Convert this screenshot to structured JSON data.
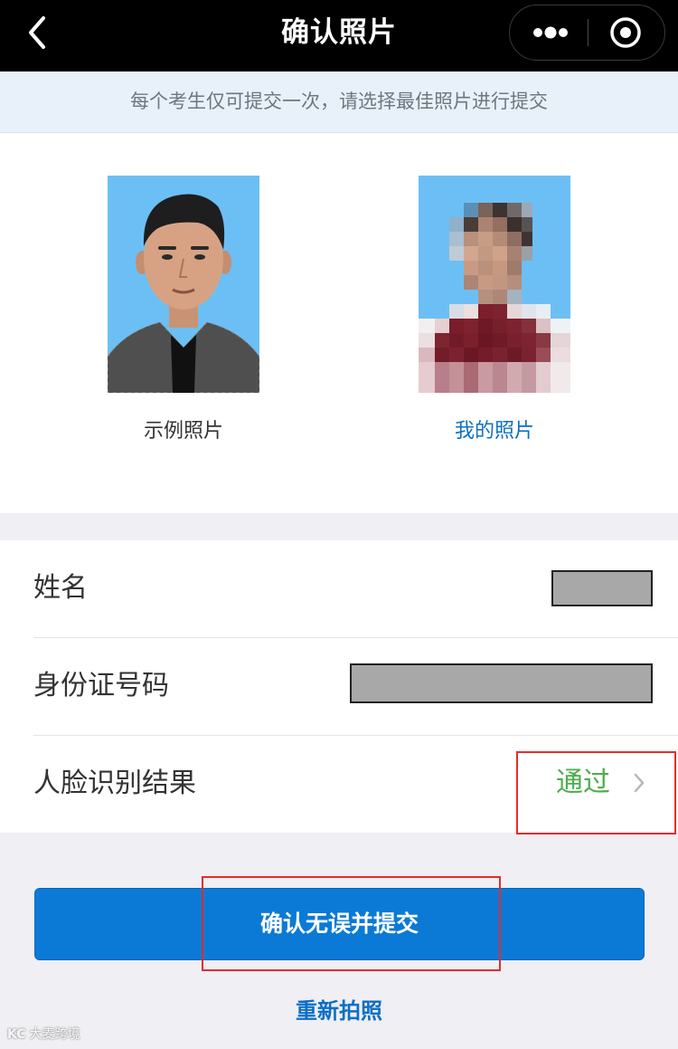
{
  "navbar": {
    "title": "确认照片",
    "back_icon": "chevron-left-icon",
    "more_icon": "more-dots-icon",
    "close_icon": "target-close-icon"
  },
  "notice": {
    "text": "每个考生仅可提交一次，请选择最佳照片进行提交"
  },
  "photos": {
    "sample_caption": "示例照片",
    "mine_caption": "我的照片"
  },
  "info": {
    "name_label": "姓名",
    "id_label": "身份证号码",
    "face_label": "人脸识别结果",
    "face_result": "通过"
  },
  "actions": {
    "submit_label": "确认无误并提交",
    "retake_label": "重新拍照"
  },
  "watermark": {
    "logo": "KC",
    "text": "大麦跨境"
  },
  "colors": {
    "primary": "#0b7ad6",
    "link": "#0c6fc6",
    "success": "#4cae4c",
    "highlight": "#e52c2c",
    "photo_bg": "#6cbff4"
  }
}
